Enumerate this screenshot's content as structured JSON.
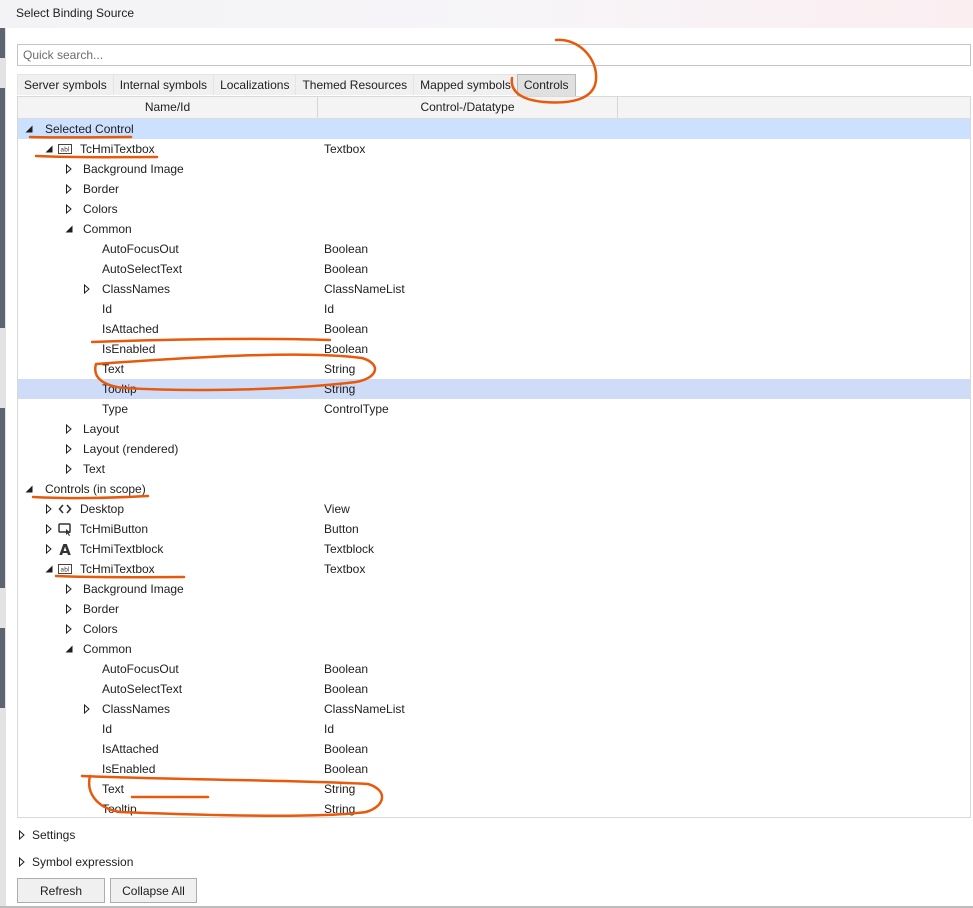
{
  "window": {
    "title": "Select Binding Source"
  },
  "search": {
    "placeholder": "Quick search...",
    "value": ""
  },
  "tabs": [
    {
      "label": "Server symbols",
      "active": false
    },
    {
      "label": "Internal symbols",
      "active": false
    },
    {
      "label": "Localizations",
      "active": false
    },
    {
      "label": "Themed Resources",
      "active": false
    },
    {
      "label": "Mapped symbols",
      "active": false
    },
    {
      "label": "Controls",
      "active": true
    }
  ],
  "grid": {
    "columns": [
      "Name/Id",
      "Control-/Datatype"
    ],
    "rows": [
      {
        "level": 0,
        "arrow": "expanded",
        "icon": null,
        "label": "Selected Control",
        "type": "",
        "state": "selected"
      },
      {
        "level": 1,
        "arrow": "expanded",
        "icon": "textbox-icon",
        "label": "TcHmiTextbox",
        "type": "Textbox"
      },
      {
        "level": 2,
        "arrow": "collapsed",
        "icon": null,
        "label": "Background Image",
        "type": ""
      },
      {
        "level": 2,
        "arrow": "collapsed",
        "icon": null,
        "label": "Border",
        "type": ""
      },
      {
        "level": 2,
        "arrow": "collapsed",
        "icon": null,
        "label": "Colors",
        "type": ""
      },
      {
        "level": 2,
        "arrow": "expanded",
        "icon": null,
        "label": "Common",
        "type": ""
      },
      {
        "level": 3,
        "arrow": null,
        "icon": null,
        "label": "AutoFocusOut",
        "type": "Boolean"
      },
      {
        "level": 3,
        "arrow": null,
        "icon": null,
        "label": "AutoSelectText",
        "type": "Boolean"
      },
      {
        "level": 3,
        "arrow": "collapsed",
        "icon": null,
        "label": "ClassNames",
        "type": "ClassNameList"
      },
      {
        "level": 3,
        "arrow": null,
        "icon": null,
        "label": "Id",
        "type": "Id"
      },
      {
        "level": 3,
        "arrow": null,
        "icon": null,
        "label": "IsAttached",
        "type": "Boolean"
      },
      {
        "level": 3,
        "arrow": null,
        "icon": null,
        "label": "IsEnabled",
        "type": "Boolean"
      },
      {
        "level": 3,
        "arrow": null,
        "icon": null,
        "label": "Text",
        "type": "String"
      },
      {
        "level": 3,
        "arrow": null,
        "icon": null,
        "label": "Tooltip",
        "type": "String",
        "state": "highlighted"
      },
      {
        "level": 3,
        "arrow": null,
        "icon": null,
        "label": "Type",
        "type": "ControlType"
      },
      {
        "level": 2,
        "arrow": "collapsed",
        "icon": null,
        "label": "Layout",
        "type": ""
      },
      {
        "level": 2,
        "arrow": "collapsed",
        "icon": null,
        "label": "Layout (rendered)",
        "type": ""
      },
      {
        "level": 2,
        "arrow": "collapsed",
        "icon": null,
        "label": "Text",
        "type": ""
      },
      {
        "level": 0,
        "arrow": "expanded",
        "icon": null,
        "label": "Controls (in scope)",
        "type": ""
      },
      {
        "level": 1,
        "arrow": "collapsed",
        "icon": "code-icon",
        "label": "Desktop",
        "type": "View"
      },
      {
        "level": 1,
        "arrow": "collapsed",
        "icon": "button-icon",
        "label": "TcHmiButton",
        "type": "Button"
      },
      {
        "level": 1,
        "arrow": "collapsed",
        "icon": "textblock-icon",
        "label": "TcHmiTextblock",
        "type": "Textblock"
      },
      {
        "level": 1,
        "arrow": "expanded",
        "icon": "textbox-icon",
        "label": "TcHmiTextbox",
        "type": "Textbox"
      },
      {
        "level": 2,
        "arrow": "collapsed",
        "icon": null,
        "label": "Background Image",
        "type": ""
      },
      {
        "level": 2,
        "arrow": "collapsed",
        "icon": null,
        "label": "Border",
        "type": ""
      },
      {
        "level": 2,
        "arrow": "collapsed",
        "icon": null,
        "label": "Colors",
        "type": ""
      },
      {
        "level": 2,
        "arrow": "expanded",
        "icon": null,
        "label": "Common",
        "type": ""
      },
      {
        "level": 3,
        "arrow": null,
        "icon": null,
        "label": "AutoFocusOut",
        "type": "Boolean"
      },
      {
        "level": 3,
        "arrow": null,
        "icon": null,
        "label": "AutoSelectText",
        "type": "Boolean"
      },
      {
        "level": 3,
        "arrow": "collapsed",
        "icon": null,
        "label": "ClassNames",
        "type": "ClassNameList"
      },
      {
        "level": 3,
        "arrow": null,
        "icon": null,
        "label": "Id",
        "type": "Id"
      },
      {
        "level": 3,
        "arrow": null,
        "icon": null,
        "label": "IsAttached",
        "type": "Boolean"
      },
      {
        "level": 3,
        "arrow": null,
        "icon": null,
        "label": "IsEnabled",
        "type": "Boolean"
      },
      {
        "level": 3,
        "arrow": null,
        "icon": null,
        "label": "Text",
        "type": "String"
      },
      {
        "level": 3,
        "arrow": null,
        "icon": null,
        "label": "Tooltip",
        "type": "String"
      }
    ]
  },
  "bottom": {
    "settings_label": "Settings",
    "symbol_expression_label": "Symbol expression"
  },
  "buttons": {
    "refresh": "Refresh",
    "collapse_all": "Collapse All"
  },
  "annotation_color": "#e8590c",
  "colors": {
    "selected_row": "#cce0ff",
    "highlighted_row": "#cfdcf7",
    "active_tab": "#e0e0e0"
  }
}
